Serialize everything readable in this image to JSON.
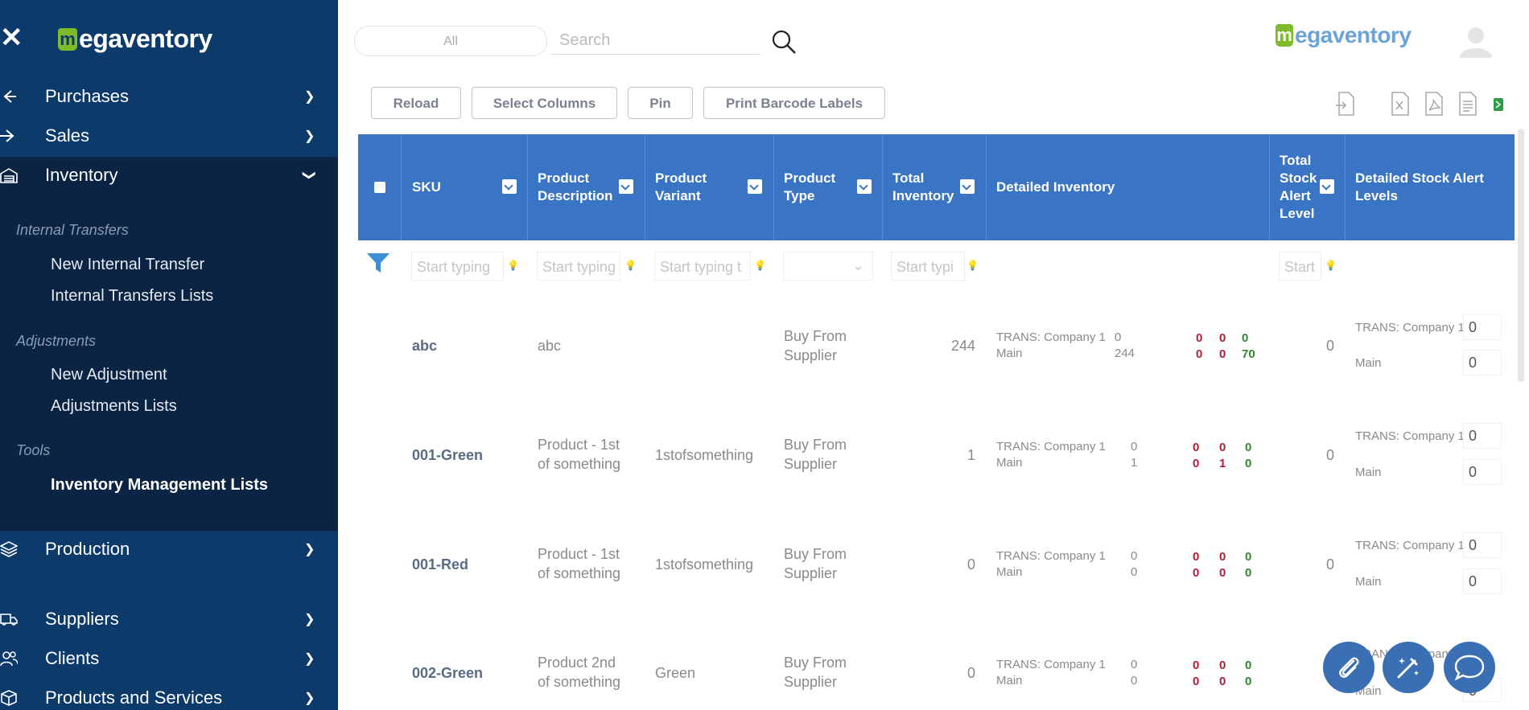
{
  "sidebar": {
    "logo": {
      "mark": "m",
      "text": "egaventory"
    },
    "nav": [
      {
        "label": "Purchases",
        "icon": "arrow-left-icon"
      },
      {
        "label": "Sales",
        "icon": "arrow-right-icon"
      },
      {
        "label": "Inventory",
        "icon": "warehouse-icon"
      },
      {
        "label": "Production",
        "icon": "layers-icon"
      },
      {
        "label": "Suppliers",
        "icon": "truck-icon"
      },
      {
        "label": "Clients",
        "icon": "users-icon"
      },
      {
        "label": "Products and Services",
        "icon": "box-icon"
      }
    ],
    "sections": {
      "internal_transfers": {
        "title": "Internal Transfers",
        "items": [
          "New Internal Transfer",
          "Internal Transfers Lists"
        ]
      },
      "adjustments": {
        "title": "Adjustments",
        "items": [
          "New Adjustment",
          "Adjustments Lists"
        ]
      },
      "tools": {
        "title": "Tools",
        "items": [
          "Inventory Management Lists"
        ]
      }
    }
  },
  "header": {
    "filter_label": "All",
    "search_placeholder": "Search",
    "logo": {
      "mark": "m",
      "text": "egaventory"
    }
  },
  "toolbar": {
    "reload": "Reload",
    "select_columns": "Select Columns",
    "pin": "Pin",
    "print_barcode": "Print Barcode Labels"
  },
  "table": {
    "columns": {
      "sku": "SKU",
      "product_description": [
        "Product",
        "Description"
      ],
      "product_variant": [
        "Product",
        "Variant"
      ],
      "product_type": [
        "Product",
        "Type"
      ],
      "total_inventory": [
        "Total",
        "Inventory"
      ],
      "detailed_inventory": "Detailed Inventory",
      "total_stock_alert": [
        "Total",
        "Stock",
        "Alert",
        "Level"
      ],
      "detailed_stock_alert": [
        "Detailed Stock Alert",
        "Levels"
      ]
    },
    "filter_placeholders": {
      "sku": "Start typing",
      "desc": "Start typing",
      "variant": "Start typing t",
      "total": "Start typi",
      "alert": "Start"
    },
    "rows": [
      {
        "sku": "abc",
        "desc": [
          "abc",
          ""
        ],
        "variant": "",
        "type": [
          "Buy From",
          "Supplier"
        ],
        "total": "244",
        "loc1": "TRANS: Company 1",
        "loc1_qty": "0",
        "loc2": "Main",
        "loc2_qty": "244",
        "s1": [
          "0",
          "0",
          "0"
        ],
        "s2": [
          "0",
          "0",
          "70"
        ],
        "alert_total": "0",
        "alert1_label": "TRANS: Company 1",
        "alert1": "0",
        "alert2_label": "Main",
        "alert2": "0"
      },
      {
        "sku": "001-Green",
        "desc": [
          "Product - 1st",
          "of something"
        ],
        "variant": "1stofsomething",
        "type": [
          "Buy From",
          "Supplier"
        ],
        "total": "1",
        "loc1": "TRANS: Company 1",
        "loc1_qty": "0",
        "loc2": "Main",
        "loc2_qty": "1",
        "s1": [
          "0",
          "0",
          "0"
        ],
        "s2": [
          "0",
          "1",
          "0"
        ],
        "alert_total": "0",
        "alert1_label": "TRANS: Company 1",
        "alert1": "0",
        "alert2_label": "Main",
        "alert2": "0"
      },
      {
        "sku": "001-Red",
        "desc": [
          "Product - 1st",
          "of something"
        ],
        "variant": "1stofsomething",
        "type": [
          "Buy From",
          "Supplier"
        ],
        "total": "0",
        "loc1": "TRANS: Company 1",
        "loc1_qty": "0",
        "loc2": "Main",
        "loc2_qty": "0",
        "s1": [
          "0",
          "0",
          "0"
        ],
        "s2": [
          "0",
          "0",
          "0"
        ],
        "alert_total": "0",
        "alert1_label": "TRANS: Company 1",
        "alert1": "0",
        "alert2_label": "Main",
        "alert2": "0"
      },
      {
        "sku": "002-Green",
        "desc": [
          "Product 2nd",
          "of something"
        ],
        "variant": "Green",
        "type": [
          "Buy From",
          "Supplier"
        ],
        "total": "0",
        "loc1": "TRANS: Company 1",
        "loc1_qty": "0",
        "loc2": "Main",
        "loc2_qty": "0",
        "s1": [
          "0",
          "0",
          "0"
        ],
        "s2": [
          "0",
          "0",
          "0"
        ],
        "alert_total": "",
        "alert1_label": "TRANS: Company 1",
        "alert1": "",
        "alert2_label": "Main",
        "alert2": "0"
      }
    ]
  },
  "colors": {
    "sidebar_bg": "#0e2b52",
    "header_blue": "#3a74c4",
    "brand_green": "#7dbb2b",
    "stock_red": "#b01e3a",
    "stock_green": "#2e8a2e"
  }
}
